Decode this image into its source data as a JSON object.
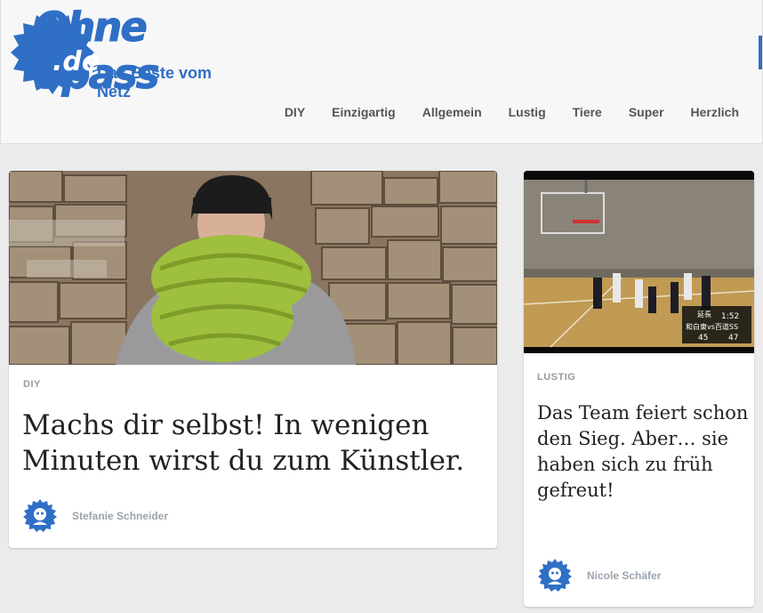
{
  "header": {
    "logo_main": "Ohne Spass",
    "logo_domain": ".de",
    "tagline": "Das Beste vom Netz",
    "brand_color": "#2f6fc6"
  },
  "nav": {
    "items": [
      "DIY",
      "Einzigartig",
      "Allgemein",
      "Lustig",
      "Tiere",
      "Super",
      "Herzlich"
    ]
  },
  "articles": [
    {
      "category": "DIY",
      "title": "Machs dir selbst! In wenigen Minuten wirst du zum Künstler.",
      "author": "Stefanie Schneider",
      "image": "woman-green-scarf-stone-wall"
    },
    {
      "category": "LUSTIG",
      "title": "Das Team feiert schon den Sieg. Aber… sie haben sich zu früh gefreut!",
      "author": "Nicole Schäfer",
      "image": "basketball-game-screenshot",
      "overlay_text": [
        "延長",
        "1:52",
        "和白東vs百道SS",
        "45",
        "47"
      ]
    }
  ]
}
